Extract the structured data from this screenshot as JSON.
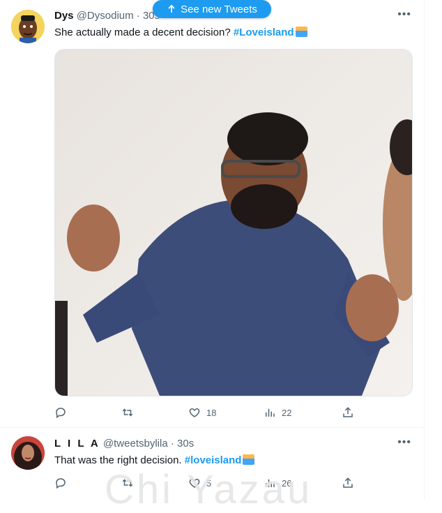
{
  "new_tweets_pill": {
    "label": "See new Tweets"
  },
  "tweets": [
    {
      "display_name": "Dys",
      "handle": "@Dysodium",
      "separator": " · ",
      "time": "30s",
      "text": "She actually made a decent decision? ",
      "hashtag": "#Loveisland",
      "more": "•••",
      "media": {
        "description_icon": "gesture-meme-image"
      },
      "stats": {
        "replies": "",
        "retweets": "",
        "likes": "18",
        "views": "22"
      }
    },
    {
      "display_name": "L I L A",
      "handle": "@tweetsbylila",
      "separator": " · ",
      "time": "30s",
      "text": "That was the right decision. ",
      "hashtag": "#loveisland",
      "more": "•••",
      "stats": {
        "replies": "",
        "retweets": "",
        "likes": "5",
        "views": "26"
      }
    }
  ],
  "watermark": "Chi Yazau",
  "colors": {
    "accent": "#1d9bf0",
    "muted": "#536471",
    "border": "#eff3f4"
  },
  "icons": [
    "arrow-up-icon",
    "more-icon",
    "reply-icon",
    "retweet-icon",
    "like-icon",
    "views-icon",
    "share-icon"
  ]
}
